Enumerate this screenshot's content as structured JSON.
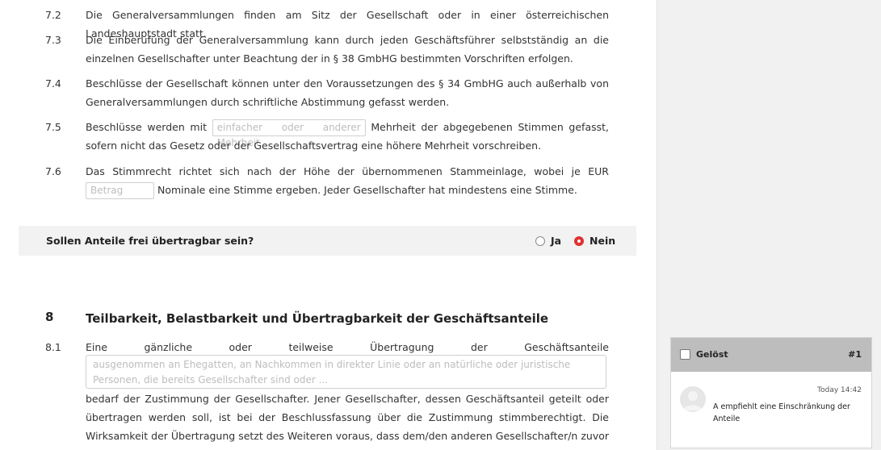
{
  "clauses": [
    {
      "num": "7.2",
      "text": "Die Generalversammlungen finden am Sitz der Gesellschaft oder in einer österreichischen Landeshauptstadt statt."
    },
    {
      "num": "7.3",
      "text": "Die Einberufung der Generalversammlung kann durch jeden Geschäftsführer selbstständig an die einzelnen Gesellschafter unter Beachtung der in § 38 GmbHG bestimmten Vorschriften erfolgen."
    },
    {
      "num": "7.4",
      "text": "Beschlüsse der Gesellschaft können unter den Voraussetzungen des § 34 GmbHG auch außerhalb von Generalversammlungen durch schriftliche Abstimmung gefasst werden."
    },
    {
      "num": "7.5",
      "before": "Beschlüsse werden mit",
      "placeholder": "einfacher oder anderer Mehrheit",
      "after": "Mehrheit der abgegebenen Stimmen gefasst, sofern nicht das Gesetz oder der Gesellschaftsvertrag eine höhere Mehrheit vorschreiben."
    },
    {
      "num": "7.6",
      "before": "Das Stimmrecht richtet sich nach der Höhe der übernommenen Stammeinlage, wobei je EUR",
      "placeholder": "Betrag",
      "after": "Nominale eine Stimme ergeben. Jeder Gesellschafter hat mindestens eine Stimme."
    }
  ],
  "question": {
    "text": "Sollen Anteile frei übertragbar sein?",
    "options": [
      {
        "label": "Ja",
        "selected": false
      },
      {
        "label": "Nein",
        "selected": true
      }
    ],
    "accent": "#e03131"
  },
  "section": {
    "num": "8",
    "title": "Teilbarkeit, Belastbarkeit und Übertragbarkeit der Geschäftsanteile"
  },
  "clause81": {
    "num": "8.1",
    "words": [
      "Eine",
      "gänzliche",
      "oder",
      "teilweise",
      "Übertragung",
      "der",
      "Geschäftsanteile"
    ],
    "placeholder": "ausgenommen an Ehegatten, an Nachkommen in direkter Linie oder an natürliche oder juristische Personen, die bereits Gesellschafter sind oder ...",
    "after": "bedarf der Zustimmung der Gesellschafter. Jener Gesellschafter, dessen Geschäftsanteil geteilt oder übertragen werden soll, ist bei der Beschlussfassung über die Zustimmung stimmberechtigt. Die Wirksamkeit der Übertragung setzt des Weiteren voraus, dass dem/den anderen Gesellschafter/n zuvor Gelegenheit gegeben wurde, das"
  },
  "comment": {
    "resolved_label": "Gelöst",
    "number": "#1",
    "time": "Today 14:42",
    "text": "A empfiehlt eine Einschränkung der Anteile"
  }
}
